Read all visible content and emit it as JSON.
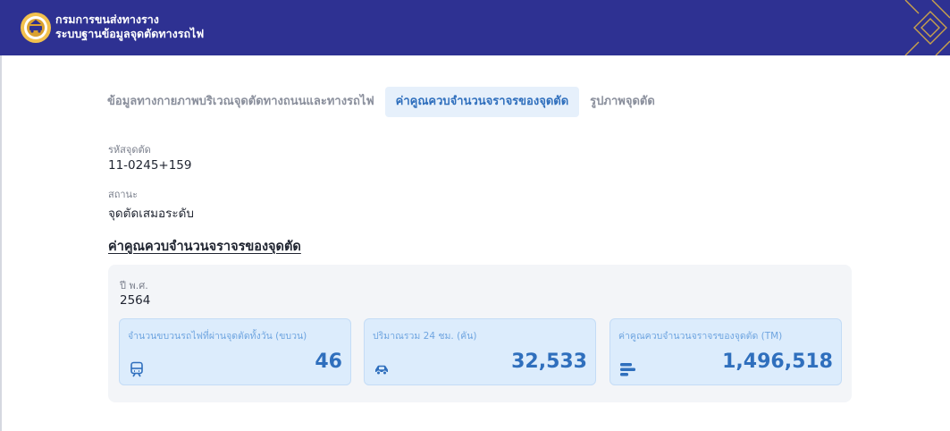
{
  "header": {
    "title": "กรมการขนส่งทางราง",
    "subtitle": "ระบบฐานข้อมูลจุดตัดทางรถไฟ"
  },
  "tabs": [
    {
      "label": "ข้อมูลทางกายภาพบริเวณจุดตัดทางถนนและทางรถไฟ",
      "active": false
    },
    {
      "label": "ค่าคูณควบจำนวนจราจรของจุดตัด",
      "active": true
    },
    {
      "label": "รูปภาพจุดตัด",
      "active": false
    }
  ],
  "crossing": {
    "code_label": "รหัสจุดตัด",
    "code_value": "11-0245+159",
    "status_label": "สถานะ",
    "status_value": "จุดตัดเสมอระดับ"
  },
  "section": {
    "title": "ค่าคูณควบจำนวนจราจรของจุดตัด",
    "year_label": "ปี พ.ศ.",
    "year_value": "2564"
  },
  "cards": [
    {
      "label": "จำนวนขบวนรถไฟที่ผ่านจุดตัดทั้งวัน (ขบวน)",
      "value": "46",
      "icon": "train-icon"
    },
    {
      "label": "ปริมาณรวม 24 ชม. (คัน)",
      "value": "32,533",
      "icon": "car-icon"
    },
    {
      "label": "ค่าคูณควบจำนวนจราจรของจุดตัด (TM)",
      "value": "1,496,518",
      "icon": "bar-stack-icon"
    }
  ],
  "colors": {
    "header_bg": "#2e3192",
    "accent": "#2f6fbd",
    "card_bg": "#dcecfc"
  }
}
